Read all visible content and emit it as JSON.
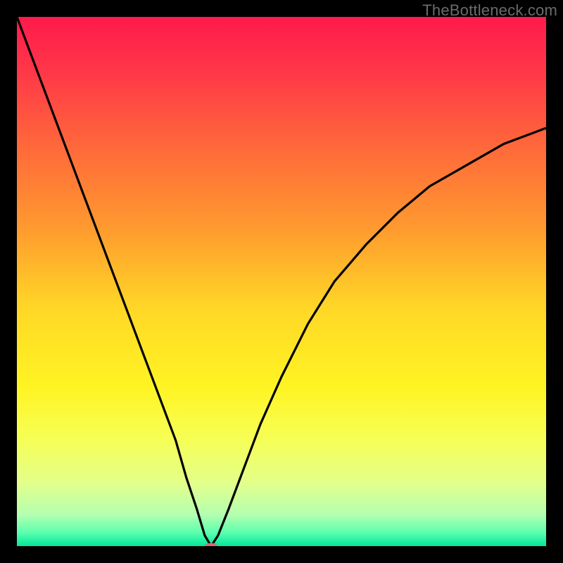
{
  "attribution": "TheBottleneck.com",
  "chart_data": {
    "type": "line",
    "title": "",
    "xlabel": "",
    "ylabel": "",
    "xlim": [
      0,
      100
    ],
    "ylim": [
      0,
      100
    ],
    "grid": false,
    "legend": false,
    "background": {
      "type": "vertical-gradient",
      "stops": [
        {
          "pos": 0.0,
          "color": "#ff1a4b"
        },
        {
          "pos": 0.1,
          "color": "#ff3648"
        },
        {
          "pos": 0.25,
          "color": "#ff6a3a"
        },
        {
          "pos": 0.4,
          "color": "#ff9a2f"
        },
        {
          "pos": 0.55,
          "color": "#ffd726"
        },
        {
          "pos": 0.7,
          "color": "#fff423"
        },
        {
          "pos": 0.8,
          "color": "#f6ff57"
        },
        {
          "pos": 0.88,
          "color": "#e3ff8a"
        },
        {
          "pos": 0.94,
          "color": "#b5ffb0"
        },
        {
          "pos": 0.975,
          "color": "#59ffad"
        },
        {
          "pos": 1.0,
          "color": "#00e79b"
        }
      ]
    },
    "series": [
      {
        "name": "bottleneck-curve",
        "color": "#000000",
        "x": [
          0,
          3,
          6,
          9,
          12,
          15,
          18,
          21,
          24,
          27,
          30,
          32,
          34,
          35.5,
          36.7,
          38,
          40,
          43,
          46,
          50,
          55,
          60,
          66,
          72,
          78,
          85,
          92,
          100
        ],
        "y": [
          100,
          92,
          84,
          76,
          68,
          60,
          52,
          44,
          36,
          28,
          20,
          13,
          7,
          2,
          0,
          2,
          7,
          15,
          23,
          32,
          42,
          50,
          57,
          63,
          68,
          72,
          76,
          79
        ]
      }
    ],
    "marker": {
      "name": "optimal-point",
      "x": 36.7,
      "y": 0,
      "color": "#d46a6a",
      "rx": 9,
      "ry": 4.5
    }
  }
}
